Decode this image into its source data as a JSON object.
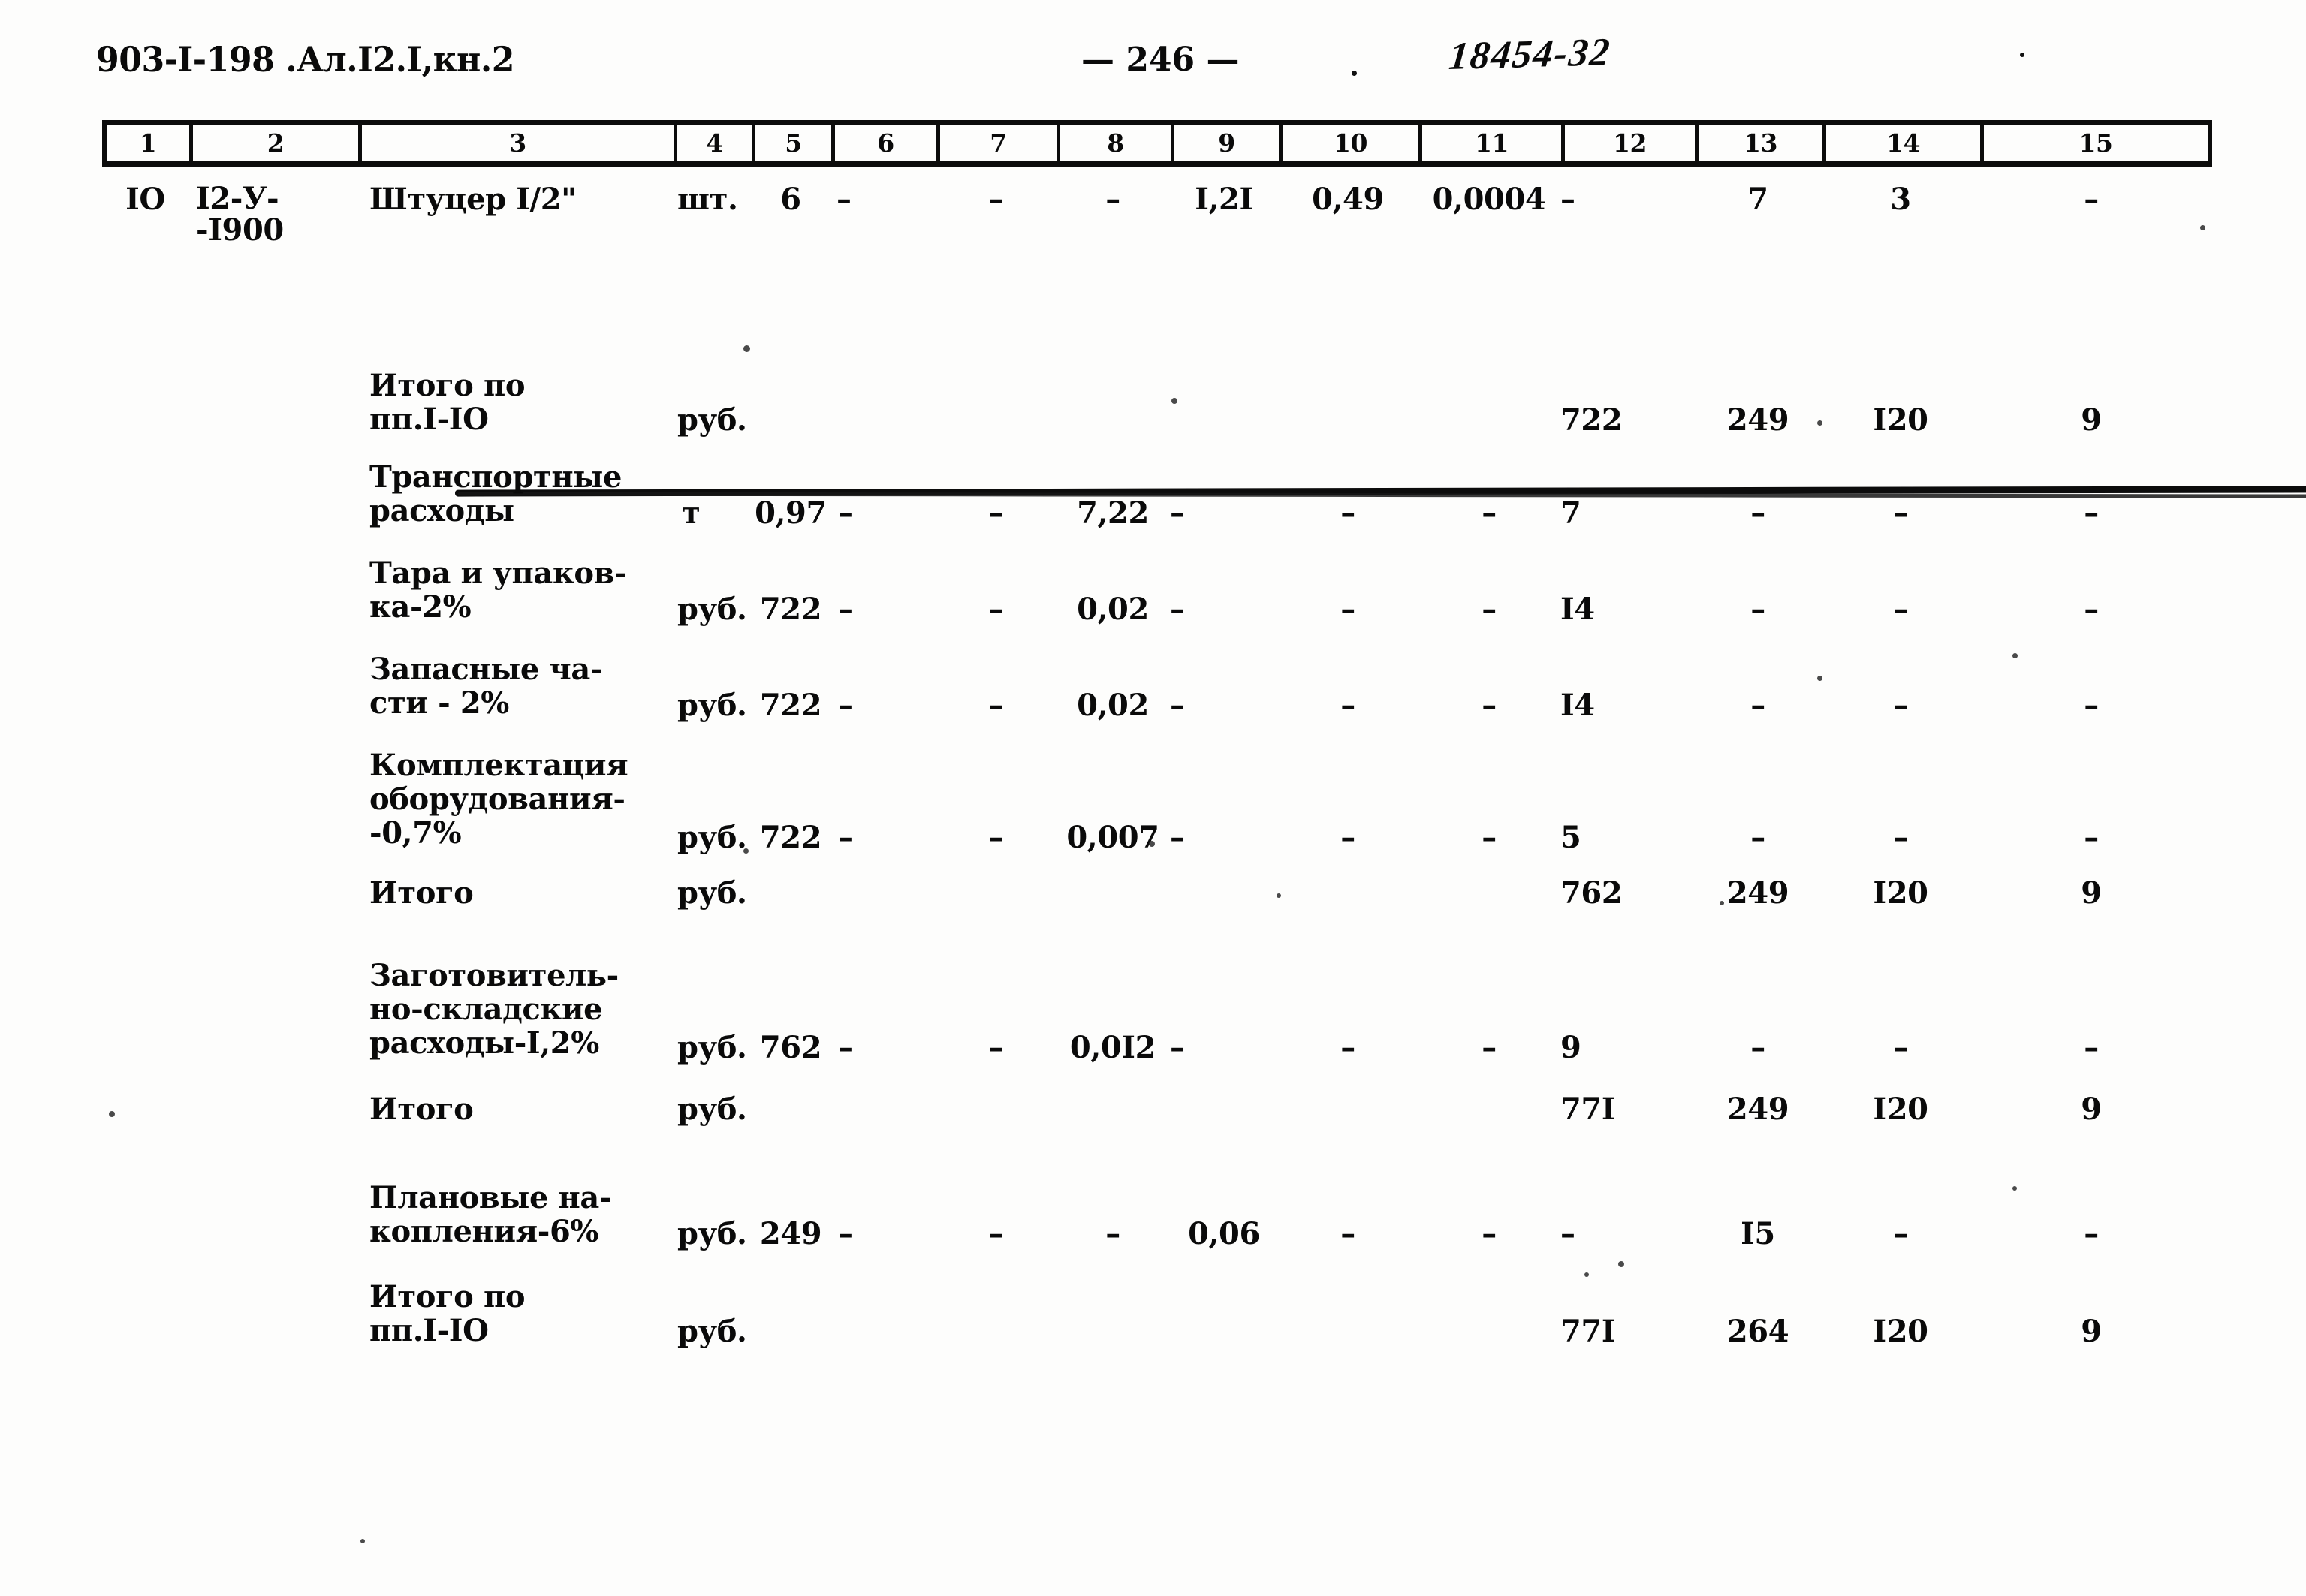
{
  "header": {
    "doc_code": "903-I-198  .Ал.I2.I,кн.2",
    "page_marker": "— 246 —",
    "handwritten_stamp": "18454-32"
  },
  "table": {
    "column_headers": [
      "1",
      "2",
      "3",
      "4",
      "5",
      "6",
      "7",
      "8",
      "9",
      "10",
      "11",
      "12",
      "13",
      "14",
      "15"
    ],
    "rows": [
      {
        "kind": "item",
        "c1": "IO",
        "c2": "I2-У-\n-I900",
        "c3": "Штуцер I/2\"",
        "c4": "шт.",
        "c5": "6",
        "c6": "–",
        "c7": "–",
        "c8": "–",
        "c9": "I,2I",
        "c10": "0,49",
        "c11": "0,0004",
        "c12": "–",
        "c13": "7",
        "c14": "3",
        "c15": "–"
      },
      {
        "kind": "total",
        "c1": "",
        "c2": "",
        "c3": "Итого по\nпп.I-IO",
        "c4": "руб.",
        "c5": "",
        "c6": "",
        "c7": "",
        "c8": "",
        "c9": "",
        "c10": "",
        "c11": "",
        "c12": "722",
        "c13": "249",
        "c14": "I20",
        "c15": "9"
      },
      {
        "kind": "line",
        "c1": "",
        "c2": "",
        "c3": "Транспортные\nрасходы",
        "c4": "т",
        "c5": "0,97",
        "c6": "–",
        "c7": "–",
        "c8": "7,22",
        "c9": "–",
        "c10": "–",
        "c11": "–",
        "c12": "7",
        "c13": "–",
        "c14": "–",
        "c15": "–"
      },
      {
        "kind": "line",
        "c1": "",
        "c2": "",
        "c3": "Тара и упаков-\nка-2%",
        "c4": "руб.",
        "c5": "722",
        "c6": "–",
        "c7": "–",
        "c8": "0,02",
        "c9": "–",
        "c10": "–",
        "c11": "–",
        "c12": "I4",
        "c13": "–",
        "c14": "–",
        "c15": "–"
      },
      {
        "kind": "line",
        "c1": "",
        "c2": "",
        "c3": "Запасные ча-\nсти - 2%",
        "c4": "руб.",
        "c5": "722",
        "c6": "–",
        "c7": "–",
        "c8": "0,02",
        "c9": "–",
        "c10": "–",
        "c11": "–",
        "c12": "I4",
        "c13": "–",
        "c14": "–",
        "c15": "–"
      },
      {
        "kind": "line",
        "c1": "",
        "c2": "",
        "c3": "Комплектация\nоборудования-\n-0,7%",
        "c4": "руб.",
        "c5": "722",
        "c6": "–",
        "c7": "–",
        "c8": "0,007",
        "c9": "–",
        "c10": "–",
        "c11": "–",
        "c12": "5",
        "c13": "–",
        "c14": "–",
        "c15": "–"
      },
      {
        "kind": "total",
        "c1": "",
        "c2": "",
        "c3": "Итого",
        "c4": "руб.",
        "c5": "",
        "c6": "",
        "c7": "",
        "c8": "",
        "c9": "",
        "c10": "",
        "c11": "",
        "c12": "762",
        "c13": "249",
        "c14": "I20",
        "c15": "9"
      },
      {
        "kind": "line",
        "c1": "",
        "c2": "",
        "c3": "Заготовитель-\nно-складские\nрасходы-I,2%",
        "c4": "руб.",
        "c5": "762",
        "c6": "–",
        "c7": "–",
        "c8": "0,0I2",
        "c9": "–",
        "c10": "–",
        "c11": "–",
        "c12": "9",
        "c13": "–",
        "c14": "–",
        "c15": "–"
      },
      {
        "kind": "total",
        "c1": "",
        "c2": "",
        "c3": "Итого",
        "c4": "руб.",
        "c5": "",
        "c6": "",
        "c7": "",
        "c8": "",
        "c9": "",
        "c10": "",
        "c11": "",
        "c12": "77I",
        "c13": "249",
        "c14": "I20",
        "c15": "9"
      },
      {
        "kind": "line",
        "c1": "",
        "c2": "",
        "c3": "Плановые на-\nкопления-6%",
        "c4": "руб.",
        "c5": "249",
        "c6": "–",
        "c7": "–",
        "c8": "–",
        "c9": "0,06",
        "c10": "–",
        "c11": "–",
        "c12": "–",
        "c13": "I5",
        "c14": "–",
        "c15": "–"
      },
      {
        "kind": "total",
        "c1": "",
        "c2": "",
        "c3": "Итого по\nпп.I-IO",
        "c4": "руб.",
        "c5": "",
        "c6": "",
        "c7": "",
        "c8": "",
        "c9": "",
        "c10": "",
        "c11": "",
        "c12": "77I",
        "c13": "264",
        "c14": "I20",
        "c15": "9"
      }
    ]
  }
}
